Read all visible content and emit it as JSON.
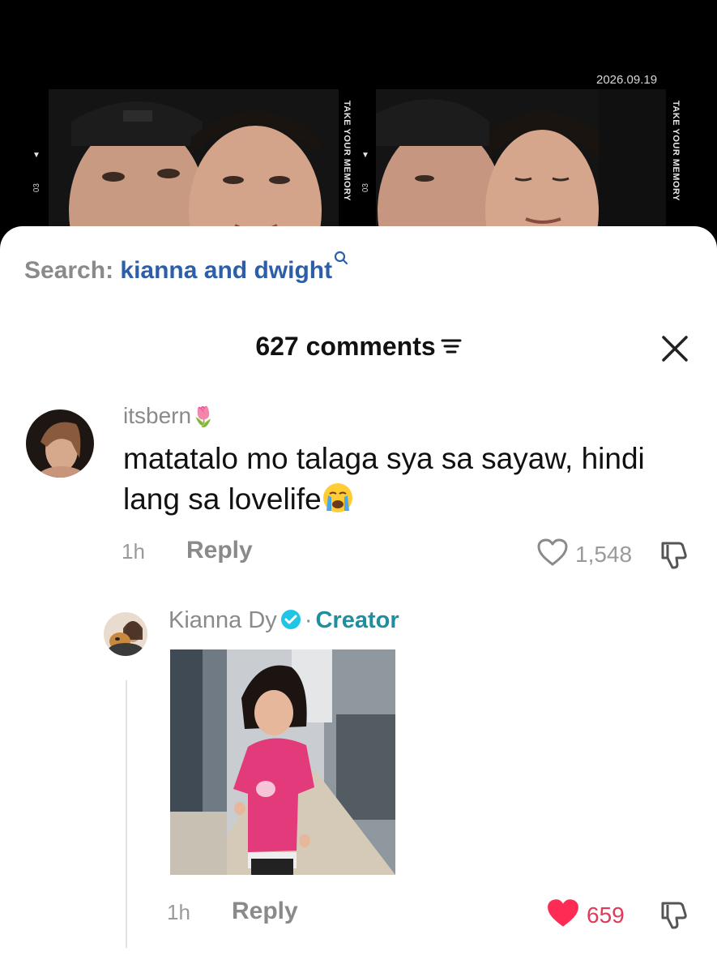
{
  "video": {
    "date_stamp": "2026.09.19",
    "strip_text": "TAKE YOUR MEMORY",
    "frame_number": "03"
  },
  "search": {
    "prefix": "Search:",
    "term": "kianna and dwight"
  },
  "comments_header": {
    "title": "627 comments"
  },
  "comments": [
    {
      "username": "itsbern",
      "username_emoji": "🌷",
      "text": "matatalo mo talaga sya sa sayaw, hindi lang sa lovelife",
      "emoji": "😭",
      "time": "1h",
      "reply_label": "Reply",
      "likes": "1,548",
      "liked": false
    },
    {
      "username": "Kianna Dy",
      "badge": "Creator",
      "separator": "·",
      "time": "1h",
      "reply_label": "Reply",
      "likes": "659",
      "liked": true
    }
  ],
  "colors": {
    "search_term": "#2c5fa8",
    "creator_badge": "#1f8fa0",
    "like_red": "#fe2c55"
  }
}
